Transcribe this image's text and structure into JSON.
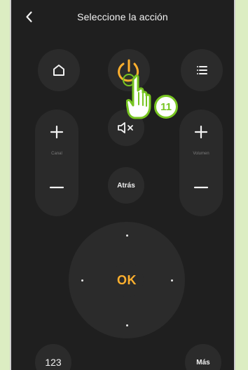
{
  "header": {
    "title": "Seleccione la acción",
    "back_icon": "chevron-left-icon"
  },
  "colors": {
    "background": "#1f1f1f",
    "button": "#2b2b2b",
    "accent_orange": "#ffb02e",
    "annotation_green": "#77c421",
    "outside_bg": "#dcedc2"
  },
  "buttons": {
    "home_icon": "home-icon",
    "power_icon": "power-icon",
    "menu_icon": "menu-icon",
    "mute_icon": "mute-icon",
    "atras_label": "Atrás",
    "ok_label": "OK",
    "numbers_label": "123",
    "more_label": "Más"
  },
  "pills": {
    "canal_label": "Canal",
    "volumen_label": "Volumen"
  },
  "annotation": {
    "step_number": "11"
  }
}
